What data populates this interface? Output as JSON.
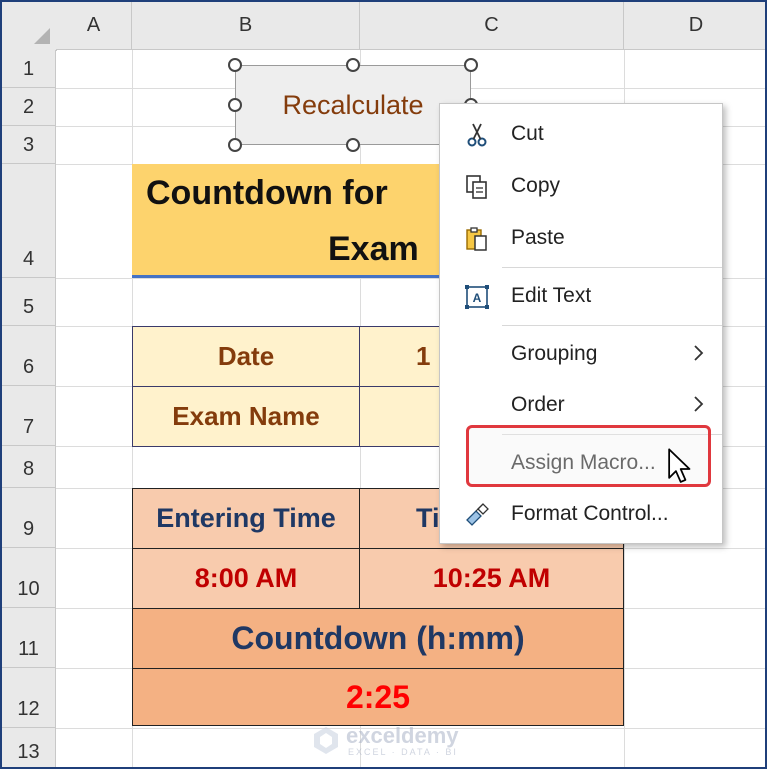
{
  "columns": [
    "A",
    "B",
    "C",
    "D"
  ],
  "rows": [
    "1",
    "2",
    "3",
    "4",
    "5",
    "6",
    "7",
    "8",
    "9",
    "10",
    "11",
    "12",
    "13"
  ],
  "button": {
    "label": "Recalculate"
  },
  "title": {
    "line1": "Countdown for",
    "line2": "Exam"
  },
  "info_table": {
    "date_label": "Date",
    "date_value_partial": "1",
    "exam_name_label": "Exam Name"
  },
  "time_table": {
    "entering_time_label": "Entering Time",
    "second_header_partial": "Ti",
    "entering_time_value": "8:00 AM",
    "second_value": "10:25 AM",
    "countdown_label": "Countdown (h:mm)",
    "countdown_value": "2:25"
  },
  "context_menu": {
    "items": [
      {
        "label": "Cut",
        "icon": "scissors-icon",
        "submenu": false
      },
      {
        "label": "Copy",
        "icon": "copy-icon",
        "submenu": false
      },
      {
        "label": "Paste",
        "icon": "paste-icon",
        "submenu": false
      },
      {
        "label": "Edit Text",
        "icon": "edit-text-icon",
        "submenu": false
      },
      {
        "label": "Grouping",
        "icon": "",
        "submenu": true
      },
      {
        "label": "Order",
        "icon": "",
        "submenu": true
      },
      {
        "label": "Assign Macro...",
        "icon": "",
        "submenu": false,
        "highlighted": true
      },
      {
        "label": "Format Control...",
        "icon": "format-control-icon",
        "submenu": false
      }
    ]
  },
  "watermark": {
    "name": "exceldemy",
    "tagline": "EXCEL · DATA · BI"
  },
  "colors": {
    "title_fill": "#fdd36d",
    "info_fill": "#fff2cc",
    "time_fill": "#f8cbad",
    "countdown_fill": "#f4b183",
    "highlight_border": "#e0383e"
  }
}
